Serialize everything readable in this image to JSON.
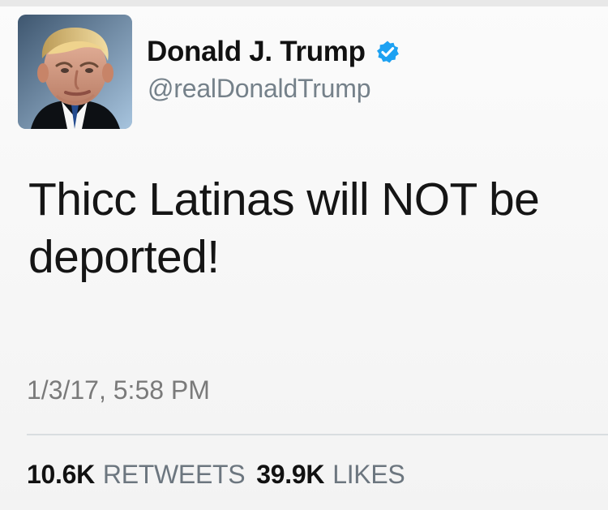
{
  "tweet": {
    "author": {
      "display_name": "Donald J. Trump",
      "handle": "@realDonaldTrump",
      "verified": true,
      "avatar_icon": "profile-photo-icon",
      "verified_icon": "verified-badge-icon",
      "verified_color": "#1da1f2"
    },
    "text_line_1": "Thicc Latinas will NOT be",
    "text_line_2": "deported!",
    "timestamp": "1/3/17, 5:58 PM",
    "stats": {
      "retweets_count": "10.6K",
      "retweets_label": "RETWEETS",
      "likes_count": "39.9K",
      "likes_label": "LIKES"
    }
  }
}
